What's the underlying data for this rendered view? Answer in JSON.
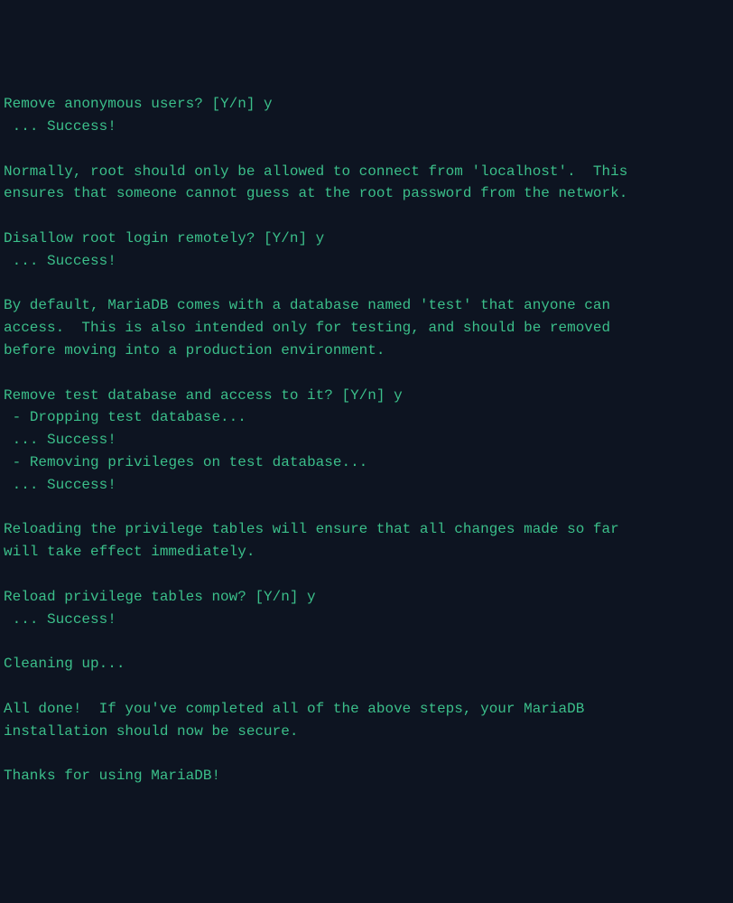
{
  "terminal": {
    "lines": [
      "Remove anonymous users? [Y/n] y",
      " ... Success!",
      "",
      "Normally, root should only be allowed to connect from 'localhost'.  This",
      "ensures that someone cannot guess at the root password from the network.",
      "",
      "Disallow root login remotely? [Y/n] y",
      " ... Success!",
      "",
      "By default, MariaDB comes with a database named 'test' that anyone can",
      "access.  This is also intended only for testing, and should be removed",
      "before moving into a production environment.",
      "",
      "Remove test database and access to it? [Y/n] y",
      " - Dropping test database...",
      " ... Success!",
      " - Removing privileges on test database...",
      " ... Success!",
      "",
      "Reloading the privilege tables will ensure that all changes made so far",
      "will take effect immediately.",
      "",
      "Reload privilege tables now? [Y/n] y",
      " ... Success!",
      "",
      "Cleaning up...",
      "",
      "All done!  If you've completed all of the above steps, your MariaDB",
      "installation should now be secure.",
      "",
      "Thanks for using MariaDB!"
    ]
  }
}
